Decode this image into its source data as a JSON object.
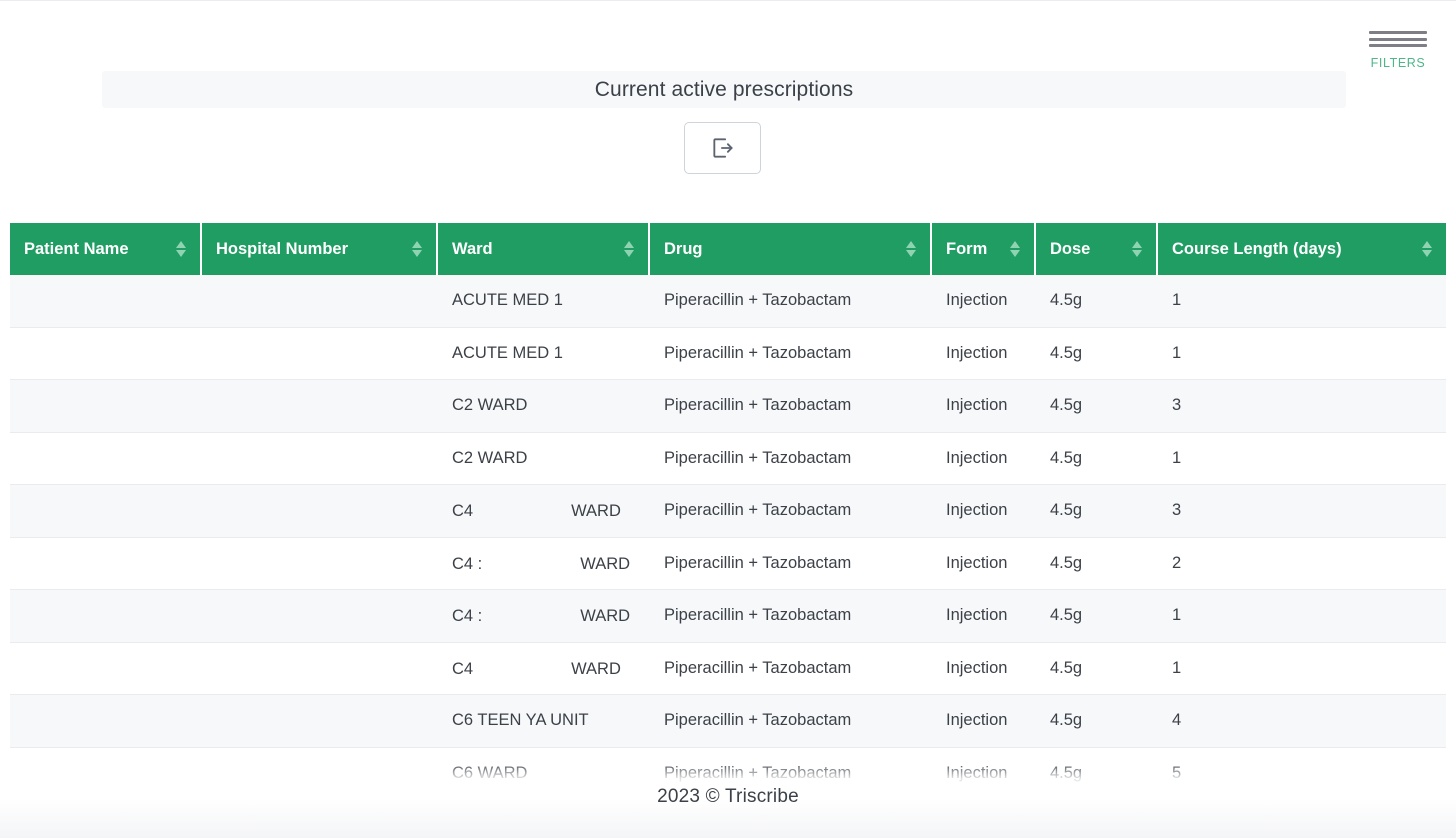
{
  "header": {
    "filters_label": "FILTERS",
    "hamburger_icon": "hamburger-icon"
  },
  "title_banner": {
    "title": "Current active prescriptions"
  },
  "toolbar": {
    "export_icon": "export-icon",
    "export_label": ""
  },
  "colors": {
    "header_green": "#1f9d63",
    "sort_arrow_green": "#8fd3b3",
    "filters_green": "#4fb58a",
    "row_stripe": "#f7f8fa",
    "text": "#3c4148"
  },
  "table": {
    "columns": [
      {
        "label": "Patient Name",
        "sortable": true
      },
      {
        "label": "Hospital Number",
        "sortable": true
      },
      {
        "label": "Ward",
        "sortable": true
      },
      {
        "label": "Drug",
        "sortable": true
      },
      {
        "label": "Form",
        "sortable": true
      },
      {
        "label": "Dose",
        "sortable": true
      },
      {
        "label": "Course Length (days)",
        "sortable": true
      }
    ],
    "rows": [
      {
        "patient_name": "",
        "hospital_number": "",
        "ward_prefix": "ACUTE MED 1",
        "ward_redacted": false,
        "ward_suffix": "",
        "drug": "Piperacillin + Tazobactam",
        "form": "Injection",
        "dose": "4.5g",
        "course_length": "1"
      },
      {
        "patient_name": "",
        "hospital_number": "",
        "ward_prefix": "ACUTE MED 1",
        "ward_redacted": false,
        "ward_suffix": "",
        "drug": "Piperacillin + Tazobactam",
        "form": "Injection",
        "dose": "4.5g",
        "course_length": "1"
      },
      {
        "patient_name": "",
        "hospital_number": "",
        "ward_prefix": "C2 WARD",
        "ward_redacted": false,
        "ward_suffix": "",
        "drug": "Piperacillin + Tazobactam",
        "form": "Injection",
        "dose": "4.5g",
        "course_length": "3"
      },
      {
        "patient_name": "",
        "hospital_number": "",
        "ward_prefix": "C2 WARD",
        "ward_redacted": false,
        "ward_suffix": "",
        "drug": "Piperacillin + Tazobactam",
        "form": "Injection",
        "dose": "4.5g",
        "course_length": "1"
      },
      {
        "patient_name": "",
        "hospital_number": "",
        "ward_prefix": "C4",
        "ward_redacted": true,
        "ward_suffix": "WARD",
        "drug": "Piperacillin + Tazobactam",
        "form": "Injection",
        "dose": "4.5g",
        "course_length": "3"
      },
      {
        "patient_name": "",
        "hospital_number": "",
        "ward_prefix": "C4 :",
        "ward_redacted": true,
        "ward_suffix": "WARD",
        "drug": "Piperacillin + Tazobactam",
        "form": "Injection",
        "dose": "4.5g",
        "course_length": "2"
      },
      {
        "patient_name": "",
        "hospital_number": "",
        "ward_prefix": "C4 :",
        "ward_redacted": true,
        "ward_suffix": "WARD",
        "drug": "Piperacillin + Tazobactam",
        "form": "Injection",
        "dose": "4.5g",
        "course_length": "1"
      },
      {
        "patient_name": "",
        "hospital_number": "",
        "ward_prefix": "C4",
        "ward_redacted": true,
        "ward_suffix": "WARD",
        "drug": "Piperacillin + Tazobactam",
        "form": "Injection",
        "dose": "4.5g",
        "course_length": "1"
      },
      {
        "patient_name": "",
        "hospital_number": "",
        "ward_prefix": "C6 TEEN YA UNIT",
        "ward_redacted": false,
        "ward_suffix": "",
        "drug": "Piperacillin + Tazobactam",
        "form": "Injection",
        "dose": "4.5g",
        "course_length": "4"
      },
      {
        "patient_name": "",
        "hospital_number": "",
        "ward_prefix": "C6 WARD",
        "ward_redacted": false,
        "ward_suffix": "",
        "drug": "Piperacillin + Tazobactam",
        "form": "Injection",
        "dose": "4.5g",
        "course_length": "5"
      }
    ]
  },
  "footer": {
    "copyright": "2023 © Triscribe"
  }
}
